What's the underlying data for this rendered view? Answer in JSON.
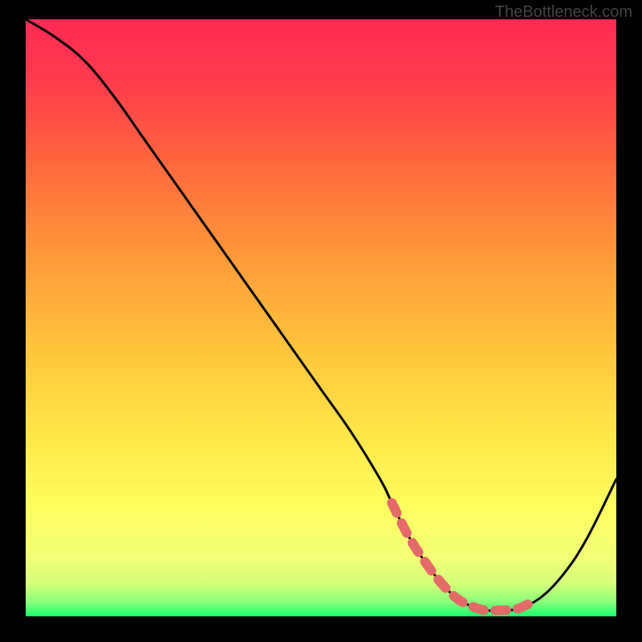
{
  "watermark": "TheBottleneck.com",
  "chart_data": {
    "type": "line",
    "title": "",
    "xlabel": "",
    "ylabel": "",
    "xlim": [
      0,
      100
    ],
    "ylim": [
      0,
      100
    ],
    "series": [
      {
        "name": "bottleneck-curve",
        "x": [
          0,
          5,
          10,
          15,
          20,
          25,
          30,
          35,
          40,
          45,
          50,
          55,
          60,
          62,
          64.5,
          67,
          70,
          73,
          76,
          78,
          80,
          83,
          87,
          91,
          95,
          100
        ],
        "values": [
          100,
          97,
          93,
          87,
          80,
          73,
          66,
          59,
          52,
          45,
          38,
          31,
          23,
          19,
          14,
          10,
          6,
          3,
          1.5,
          1,
          1,
          1.2,
          3,
          7,
          13,
          23
        ]
      }
    ],
    "highlight_range": {
      "name": "optimal-region",
      "x": [
        62,
        64.5,
        67,
        70,
        73,
        76,
        78,
        80,
        83,
        85
      ],
      "values": [
        19,
        14,
        10,
        6,
        3,
        1.5,
        1,
        1,
        1.2,
        2
      ]
    },
    "gradient_stops": [
      {
        "offset": 0.0,
        "color": "#ff2a55"
      },
      {
        "offset": 0.1,
        "color": "#ff3a4d"
      },
      {
        "offset": 0.25,
        "color": "#ff6a3e"
      },
      {
        "offset": 0.4,
        "color": "#ff9a3a"
      },
      {
        "offset": 0.55,
        "color": "#ffc43c"
      },
      {
        "offset": 0.7,
        "color": "#ffe74a"
      },
      {
        "offset": 0.82,
        "color": "#fdff60"
      },
      {
        "offset": 0.9,
        "color": "#f2ff75"
      },
      {
        "offset": 0.945,
        "color": "#d6ff7a"
      },
      {
        "offset": 0.975,
        "color": "#8cff7a"
      },
      {
        "offset": 1.0,
        "color": "#1bff6f"
      }
    ]
  }
}
